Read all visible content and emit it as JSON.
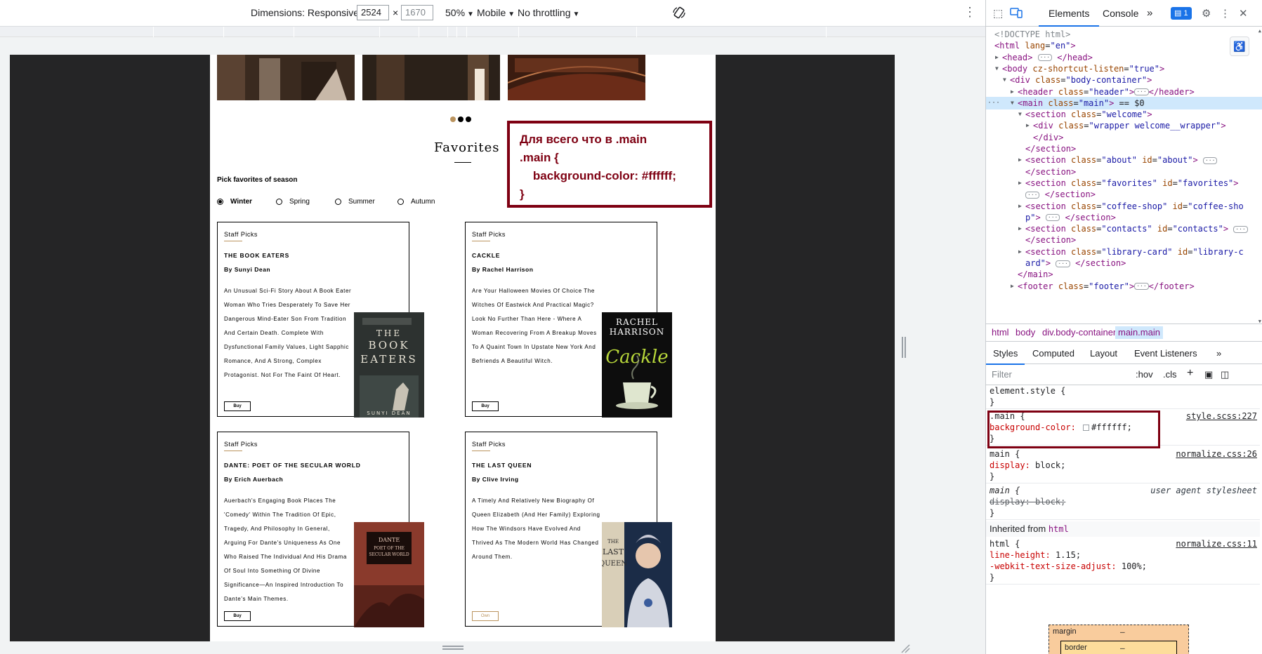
{
  "device_toolbar": {
    "dimensions_label": "Dimensions: Responsive",
    "width_value": "2524",
    "times": "×",
    "height_value": "1670",
    "zoom": "50%",
    "device_type": "Mobile",
    "throttling": "No throttling"
  },
  "page": {
    "favorites_title": "Favorites",
    "pick_label": "Pick favorites of season",
    "seasons": [
      "Winter",
      "Spring",
      "Summer",
      "Autumn"
    ],
    "selected_season": "Winter",
    "cards": [
      {
        "staff": "Staff Picks",
        "title": "THE BOOK EATERS",
        "author": "By Sunyi Dean",
        "description": "An Unusual Sci-Fi Story About A Book Eater Woman Who Tries Desperately To Save Her Dangerous Mind-Eater Son From Tradition And Certain Death. Complete With Dysfunctional Family Values, Light Sapphic Romance, And A Strong, Complex Protagonist. Not For The Faint Of Heart.",
        "button": "Buy",
        "cover_lines": [
          "THE",
          "BOOK",
          "EATERS"
        ],
        "cover_author": "SUNYI DEAN"
      },
      {
        "staff": "Staff Picks",
        "title": "CACKLE",
        "author": "By Rachel Harrison",
        "description": "Are Your Halloween Movies Of Choice The Witches Of Eastwick And Practical Magic? Look No Further Than Here - Where A Woman Recovering From A Breakup Moves To A Quaint Town In Upstate New York And Befriends A Beautiful Witch.",
        "button": "Buy",
        "cover_lines": [
          "RACHEL",
          "HARRISON"
        ],
        "cover_title": "Cackle"
      },
      {
        "staff": "Staff Picks",
        "title": "DANTE: POET OF THE SECULAR WORLD",
        "author": "By Erich Auerbach",
        "description": "Auerbach's Engaging Book Places The 'Comedy' Within The Tradition Of Epic, Tragedy, And Philosophy In General, Arguing For Dante's Uniqueness As One Who Raised The Individual And His Drama Of Soul Into Something Of Divine Significance—An Inspired Introduction To Dante's Main Themes.",
        "button": "Buy",
        "cover_lines": [
          "DANTE",
          "POET OF THE",
          "SECULAR WORLD"
        ]
      },
      {
        "staff": "Staff Picks",
        "title": "THE LAST QUEEN",
        "author": "By Clive Irving",
        "description": "A Timely And Relatively New Biography Of Queen Elizabeth (And Her Family) Exploring How The Windsors Have Evolved And Thrived As The Modern World Has Changed Around Them.",
        "button": "Own",
        "cover_lines": [
          "THE",
          "LAST",
          "QUEEN"
        ]
      }
    ],
    "annotation": "Для всего что в .main\n.main {\n    background-color: #ffffff;\n}"
  },
  "devtools": {
    "tabs": [
      "Elements",
      "Console"
    ],
    "issues_count": "1",
    "dom_lines": [
      {
        "indent": 0,
        "arrow": "",
        "html": "<span class='t-doc'>&lt;!DOCTYPE html&gt;</span>"
      },
      {
        "indent": 0,
        "arrow": "",
        "html": "<span class='t-tag'>&lt;html</span> <span class='t-attr'>lang</span>=<span class='t-val'>\"en\"</span><span class='t-tag'>&gt;</span>"
      },
      {
        "indent": 1,
        "arrow": "▶",
        "html": "<span class='t-tag'>&lt;head&gt;</span> <span class='ell'>···</span> <span class='t-tag'>&lt;/head&gt;</span>"
      },
      {
        "indent": 1,
        "arrow": "▼",
        "html": "<span class='t-tag'>&lt;body</span> <span class='t-attr'>cz-shortcut-listen</span>=<span class='t-val'>\"true\"</span><span class='t-tag'>&gt;</span>"
      },
      {
        "indent": 2,
        "arrow": "▼",
        "html": "<span class='t-tag'>&lt;div</span> <span class='t-attr'>class</span>=<span class='t-val'>\"body-container\"</span><span class='t-tag'>&gt;</span>"
      },
      {
        "indent": 3,
        "arrow": "▶",
        "html": "<span class='t-tag'>&lt;header</span> <span class='t-attr'>class</span>=<span class='t-val'>\"header\"</span><span class='t-tag'>&gt;</span><span class='ell'>···</span><span class='t-tag'>&lt;/header&gt;</span>"
      },
      {
        "indent": 3,
        "arrow": "▼",
        "sel": true,
        "html": "<span class='t-tag'>&lt;main</span> <span class='t-attr'>class</span>=<span class='t-val'>\"main\"</span><span class='t-tag'>&gt;</span> == $0"
      },
      {
        "indent": 4,
        "arrow": "▼",
        "html": "<span class='t-tag'>&lt;section</span> <span class='t-attr'>class</span>=<span class='t-val'>\"welcome\"</span><span class='t-tag'>&gt;</span>"
      },
      {
        "indent": 5,
        "arrow": "▶",
        "html": "<span class='t-tag'>&lt;div</span> <span class='t-attr'>class</span>=<span class='t-val'>\"wrapper welcome__wrapper\"</span><span class='t-tag'>&gt;</span>"
      },
      {
        "indent": 5,
        "arrow": "",
        "html": "<span class='t-tag'>&lt;/div&gt;</span>"
      },
      {
        "indent": 4,
        "arrow": "",
        "html": "<span class='t-tag'>&lt;/section&gt;</span>"
      },
      {
        "indent": 4,
        "arrow": "▶",
        "html": "<span class='t-tag'>&lt;section</span> <span class='t-attr'>class</span>=<span class='t-val'>\"about\"</span> <span class='t-attr'>id</span>=<span class='t-val'>\"about\"</span><span class='t-tag'>&gt;</span> <span class='ell'>···</span>"
      },
      {
        "indent": 4,
        "arrow": "",
        "html": "<span class='t-tag'>&lt;/section&gt;</span>"
      },
      {
        "indent": 4,
        "arrow": "▶",
        "html": "<span class='t-tag'>&lt;section</span> <span class='t-attr'>class</span>=<span class='t-val'>\"favorites\"</span> <span class='t-attr'>id</span>=<span class='t-val'>\"favorites\"</span><span class='t-tag'>&gt;</span>"
      },
      {
        "indent": 4,
        "arrow": "",
        "html": "<span class='ell'>···</span> <span class='t-tag'>&lt;/section&gt;</span>"
      },
      {
        "indent": 4,
        "arrow": "▶",
        "html": "<span class='t-tag'>&lt;section</span> <span class='t-attr'>class</span>=<span class='t-val'>\"coffee-shop\"</span> <span class='t-attr'>id</span>=<span class='t-val'>\"coffee-sho</span>"
      },
      {
        "indent": 4,
        "arrow": "",
        "html": "<span class='t-val'>p\"</span><span class='t-tag'>&gt;</span> <span class='ell'>···</span> <span class='t-tag'>&lt;/section&gt;</span>"
      },
      {
        "indent": 4,
        "arrow": "▶",
        "html": "<span class='t-tag'>&lt;section</span> <span class='t-attr'>class</span>=<span class='t-val'>\"contacts\"</span> <span class='t-attr'>id</span>=<span class='t-val'>\"contacts\"</span><span class='t-tag'>&gt;</span> <span class='ell'>···</span>"
      },
      {
        "indent": 4,
        "arrow": "",
        "html": "<span class='t-tag'>&lt;/section&gt;</span>"
      },
      {
        "indent": 4,
        "arrow": "▶",
        "html": "<span class='t-tag'>&lt;section</span> <span class='t-attr'>class</span>=<span class='t-val'>\"library-card\"</span> <span class='t-attr'>id</span>=<span class='t-val'>\"library-c</span>"
      },
      {
        "indent": 4,
        "arrow": "",
        "html": "<span class='t-val'>ard\"</span><span class='t-tag'>&gt;</span> <span class='ell'>···</span> <span class='t-tag'>&lt;/section&gt;</span>"
      },
      {
        "indent": 3,
        "arrow": "",
        "html": "<span class='t-tag'>&lt;/main&gt;</span>"
      },
      {
        "indent": 3,
        "arrow": "▶",
        "html": "<span class='t-tag'>&lt;footer</span> <span class='t-attr'>class</span>=<span class='t-val'>\"footer\"</span><span class='t-tag'>&gt;</span><span class='ell'>···</span><span class='t-tag'>&lt;/footer&gt;</span>"
      }
    ],
    "breadcrumbs": [
      "html",
      "body",
      "div.body-container",
      "main.main"
    ],
    "sub_tabs": [
      "Styles",
      "Computed",
      "Layout",
      "Event Listeners"
    ],
    "filter_placeholder": "Filter",
    "filter_hov": ":hov",
    "filter_cls": ".cls",
    "rules": {
      "element_style": "element.style {",
      "main_selector": ".main {",
      "main_source": "style.scss:227",
      "main_prop": "background-color",
      "main_value": "#ffffff;",
      "main2_selector": "main {",
      "main2_source": "normalize.css:26",
      "main2_prop": "display",
      "main2_value": "block;",
      "ua_selector": "main {",
      "ua_source": "user agent stylesheet",
      "ua_decl": "display: block;",
      "inherited_label": "Inherited from",
      "inherited_tag": "html",
      "html_selector": "html {",
      "html_source": "normalize.css:11",
      "html_prop1": "line-height",
      "html_value1": "1.15;",
      "html_prop2": "-webkit-text-size-adjust",
      "html_value2": "100%;",
      "close": "}"
    },
    "box_model": {
      "margin_label": "margin",
      "border_label": "border",
      "dash": "–"
    }
  },
  "colors": {
    "accent_gold": "#bb945f",
    "annotation_red": "#7e0012",
    "devtools_blue": "#1a73e8"
  }
}
